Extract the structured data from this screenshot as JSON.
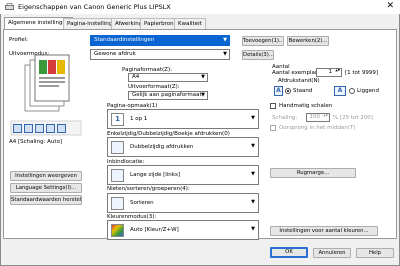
{
  "window": {
    "title": "Eigenschappen van Canon Generic Plus LIPSLX",
    "close": "✕"
  },
  "tabs": [
    "Algemene instellingen",
    "Pagina-instelling",
    "Afwerking",
    "Papierbron",
    "Kwaliteit"
  ],
  "left": {
    "profile_label": "Profiel:",
    "output_label": "Uitvoermodus:",
    "preview_caption": "A4 [Schaling: Auto]",
    "btn_view": "Instellingen weergeven",
    "btn_language": "Language Settings(I)...",
    "btn_defaults": "Standaardwaarden herstellen"
  },
  "top": {
    "profile_value": "Standaardinstellingen",
    "btn_add": "Toevoegen(1)...",
    "btn_edit": "Bewerken(2)...",
    "output_value": "Gewone afdruk",
    "btn_details": "Details(3)..."
  },
  "paper": {
    "format_label": "Paginaformaat(Z):",
    "format_value": "A4",
    "output_format_label": "Uitvoerformaat(Z):",
    "output_format_value": "Gelijk aan paginaformaat"
  },
  "copies": {
    "label": "Aantal exemplaren(C):",
    "value": "1",
    "range": "[1 tot 9999]",
    "orientation_label": "Afdrukstand(N)",
    "portrait": "Staand",
    "landscape": "Liggend"
  },
  "options": {
    "manual_scale": "Handmatig schalen",
    "scale_label": "Schaling:",
    "scale_value": "100",
    "scale_range": "% [25 tot 200]",
    "center": "Oorsprong in het midden(T)"
  },
  "layout": {
    "label": "Pagina-opmaak(1)",
    "value": "1 op 1"
  },
  "duplex": {
    "label": "Enkelzijdig/Dubbelzijdig/Boekje afdrukken(0)",
    "value": "Dubbelzijdig afdrukken"
  },
  "binding": {
    "label": "Inbindlocatie:",
    "value": "Lange zijde [links]",
    "btn_margin": "Rugmarge..."
  },
  "finishing": {
    "label": "Nieten/sorteren/groeperen(4):",
    "value": "Sorteren"
  },
  "color": {
    "label": "Kleurenmodus(3):",
    "value": "Auto [Kleur/Z+W]",
    "btn_color": "Instellingen voor aantal kleuren..."
  },
  "footer": {
    "ok": "OK",
    "cancel": "Annuleren",
    "help": "Help"
  },
  "colors": {
    "accent": "#0a64d2",
    "focus": "#2b6fd6"
  }
}
